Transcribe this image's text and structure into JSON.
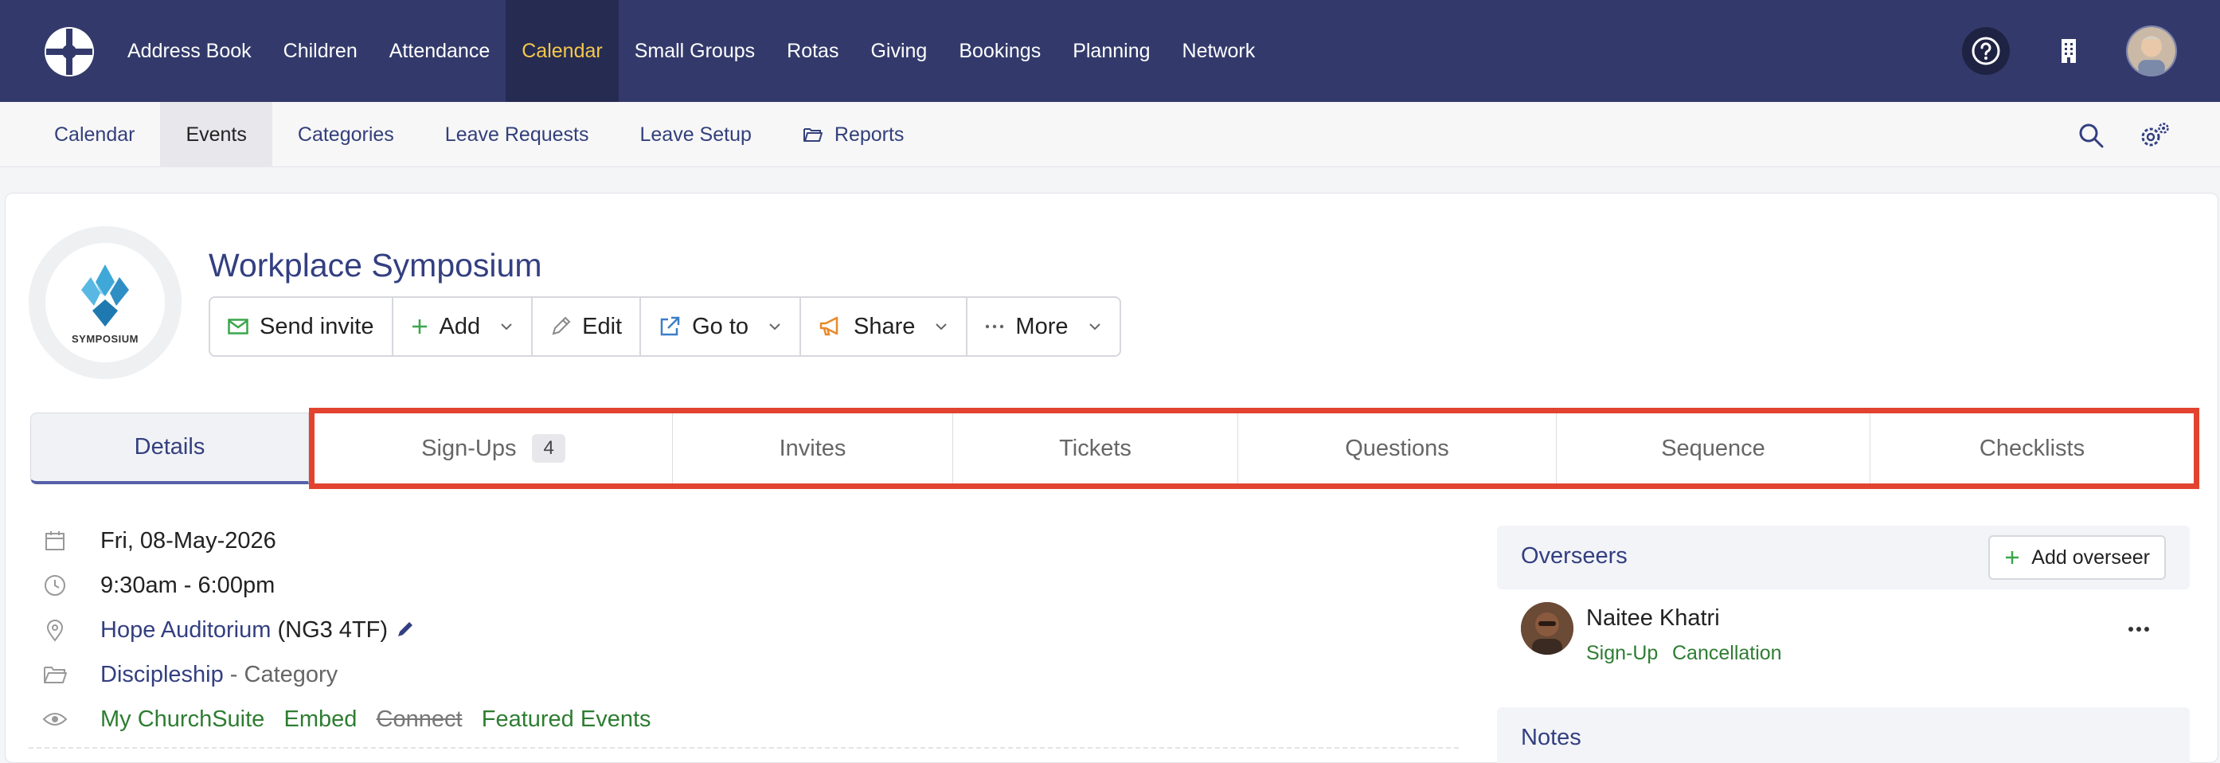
{
  "topnav": {
    "items": [
      "Address Book",
      "Children",
      "Attendance",
      "Calendar",
      "Small Groups",
      "Rotas",
      "Giving",
      "Bookings",
      "Planning",
      "Network"
    ],
    "active": "Calendar"
  },
  "subnav": {
    "items": [
      "Calendar",
      "Events",
      "Categories",
      "Leave Requests",
      "Leave Setup",
      "Reports"
    ],
    "active": "Events"
  },
  "event": {
    "logo_text": "SYMPOSIUM",
    "title": "Workplace Symposium"
  },
  "actions": {
    "send_invite": "Send invite",
    "add": "Add",
    "edit": "Edit",
    "go_to": "Go to",
    "share": "Share",
    "more": "More"
  },
  "tabs": {
    "details": "Details",
    "signups": "Sign-Ups",
    "signups_count": "4",
    "invites": "Invites",
    "tickets": "Tickets",
    "questions": "Questions",
    "sequence": "Sequence",
    "checklists": "Checklists"
  },
  "details": {
    "date": "Fri, 08-May-2026",
    "time": "9:30am - 6:00pm",
    "location": "Hope Auditorium",
    "postcode": "(NG3 4TF)",
    "category": "Discipleship",
    "category_suffix": "- Category",
    "visibility": {
      "my_churchsuite": "My ChurchSuite",
      "embed": "Embed",
      "connect": "Connect",
      "featured": "Featured Events"
    }
  },
  "overseers": {
    "title": "Overseers",
    "add_label": "Add overseer",
    "person": {
      "name": "Naitee Khatri",
      "signup": "Sign-Up",
      "cancellation": "Cancellation"
    }
  },
  "notes": {
    "title": "Notes"
  },
  "colors": {
    "nav_bg": "#333a6b",
    "nav_active": "#f5c84b",
    "highlight": "#e2432f",
    "link": "#333f80",
    "green": "#2e7d32"
  }
}
